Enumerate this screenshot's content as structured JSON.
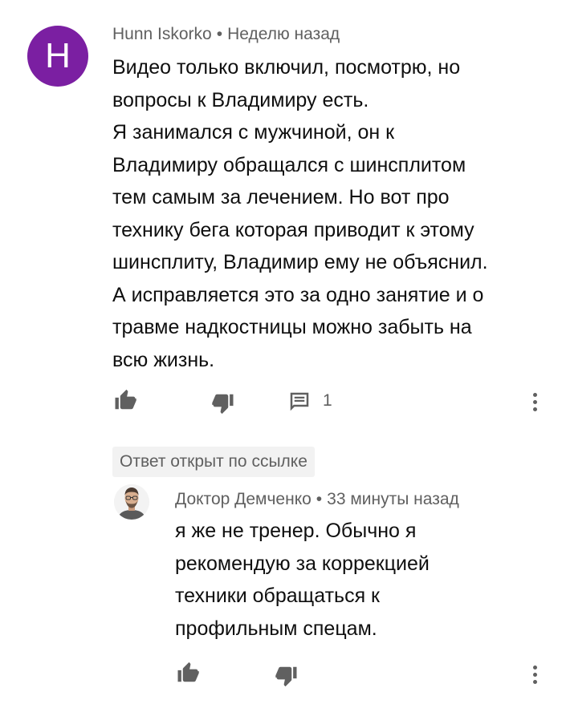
{
  "comment": {
    "avatar_letter": "H",
    "author": "Hunn Iskorko",
    "separator": "•",
    "time": "Неделю назад",
    "text": "Видео только включил, посмотрю, но\nвопросы к Владимиру есть.\nЯ занимался с мужчиной, он к\nВладимиру обращался с шинсплитом\nтем самым за лечением. Но вот про\nтехнику бега которая приводит к этому\nшинсплиту, Владимир ему не объяснил.\nА исправляется это за одно занятие и о\nтравме надкостницы можно забыть на\nвсю жизнь.",
    "reply_count": "1",
    "avatar_color": "#7b1fa2"
  },
  "highlight_badge": "Ответ открыт по ссылке",
  "reply": {
    "author": "Доктор Демченко",
    "separator": "•",
    "time": "33 минуты назад",
    "text": "я же не тренер. Обычно я\nрекомендую за коррекцией\nтехники обращаться к\nпрофильным спецам."
  },
  "icons": {
    "like": "thumbs-up-icon",
    "dislike": "thumbs-down-icon",
    "reply": "comment-icon",
    "menu": "more-vertical-icon"
  }
}
